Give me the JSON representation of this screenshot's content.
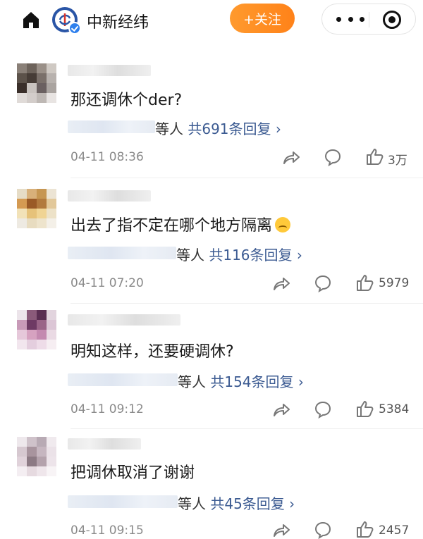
{
  "header": {
    "account_name": "中新经纬",
    "follow_label": "+关注"
  },
  "comments": [
    {
      "text": "那还调休个der?",
      "reply_suffix": "等人",
      "reply_count": "共691条回复 ›",
      "time": "04-11 08:36",
      "likes": "3万"
    },
    {
      "text": "出去了指不定在哪个地方隔离",
      "reply_suffix": "等人",
      "reply_count": "共116条回复 ›",
      "time": "04-11 07:20",
      "likes": "5979"
    },
    {
      "text": "明知这样，还要硬调休?",
      "reply_suffix": "等人",
      "reply_count": "共154条回复 ›",
      "time": "04-11 09:12",
      "likes": "5384"
    },
    {
      "text": "把调休取消了谢谢",
      "reply_suffix": "等人",
      "reply_count": "共45条回复 ›",
      "time": "04-11 09:15",
      "likes": "2457"
    }
  ],
  "colors": {
    "follow_button": "#ff8a22",
    "reply_link": "#3c5b92",
    "meta_text": "#8a8a8a"
  }
}
